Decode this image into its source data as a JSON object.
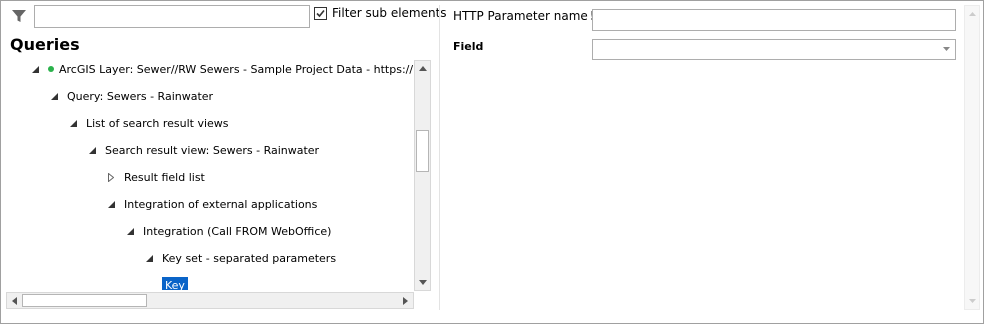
{
  "filter": {
    "input_value": "",
    "checkbox_label": "Filter sub elements",
    "checkbox_checked": true
  },
  "queries": {
    "title": "Queries",
    "tree": [
      {
        "label": "ArcGIS Layer: Sewer//RW Sewers - Sample Project Data - https://w-ws-",
        "level": 0,
        "expanded": true,
        "status": "green"
      },
      {
        "label": "Query: Sewers - Rainwater",
        "level": 1,
        "expanded": true
      },
      {
        "label": "List of search result views",
        "level": 2,
        "expanded": true
      },
      {
        "label": "Search result view: Sewers - Rainwater",
        "level": 3,
        "expanded": true
      },
      {
        "label": "Result field list",
        "level": 4,
        "expanded": false
      },
      {
        "label": "Integration of external applications",
        "level": 4,
        "expanded": true
      },
      {
        "label": "Integration (Call FROM WebOffice)",
        "level": 5,
        "expanded": true
      },
      {
        "label": "Key set - separated parameters",
        "level": 6,
        "expanded": true
      },
      {
        "label": "Key",
        "level": 7,
        "selected": true
      }
    ]
  },
  "properties": {
    "http_param_label": "HTTP Parameter name",
    "required_mark": "!",
    "http_param_value": "",
    "field_label": "Field",
    "field_value": ""
  }
}
